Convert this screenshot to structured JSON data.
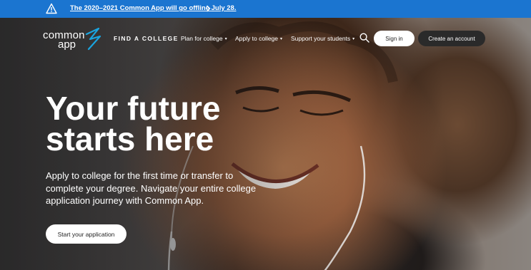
{
  "alert": {
    "text": "The 2020–2021 Common App will go offline July 28.",
    "icon": "warning-icon",
    "chevron_icon": "chevron-right-icon",
    "background": "#1b75d0"
  },
  "logo": {
    "line1": "common",
    "line2": "app",
    "accent_color": "#1aa5e0"
  },
  "nav": {
    "find_college": "FIND A COLLEGE",
    "items": [
      {
        "label": "Plan for college",
        "caret": "▾"
      },
      {
        "label": "Apply to college",
        "caret": "▾"
      },
      {
        "label": "Support your students",
        "caret": "▾"
      }
    ],
    "search_icon": "search-icon",
    "signin_label": "Sign in",
    "create_account_label": "Create an account"
  },
  "hero": {
    "headline_line1": "Your future",
    "headline_line2": "starts here",
    "subtext": "Apply to college for the first time or transfer to complete your degree. Navigate your entire college application journey with Common App.",
    "cta_label": "Start your application"
  }
}
